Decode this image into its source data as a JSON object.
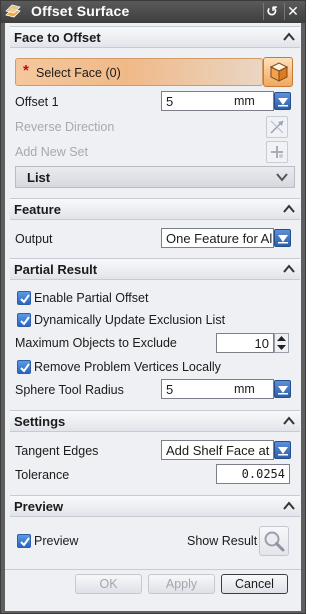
{
  "window": {
    "title": "Offset Surface",
    "controls": {
      "reset": "↺",
      "close": "✕"
    }
  },
  "sections": {
    "face_to_offset": {
      "title": "Face to Offset",
      "select_face": {
        "required_marker": "*",
        "label": "Select Face (0)"
      },
      "offset": {
        "label": "Offset 1",
        "value": "5",
        "unit": "mm"
      },
      "reverse_direction": {
        "label": "Reverse Direction"
      },
      "add_new_set": {
        "label": "Add New Set"
      },
      "list": {
        "label": "List"
      }
    },
    "feature": {
      "title": "Feature",
      "output": {
        "label": "Output",
        "value": "One Feature for Al"
      }
    },
    "partial_result": {
      "title": "Partial Result",
      "enable_partial_offset": {
        "label": "Enable Partial Offset",
        "checked": true
      },
      "dynamically_update": {
        "label": "Dynamically Update Exclusion List",
        "checked": true
      },
      "max_objects": {
        "label": "Maximum Objects to Exclude",
        "value": "10"
      },
      "remove_problem_vertices": {
        "label": "Remove Problem Vertices Locally",
        "checked": true
      },
      "sphere_tool_radius": {
        "label": "Sphere Tool Radius",
        "value": "5",
        "unit": "mm"
      }
    },
    "settings": {
      "title": "Settings",
      "tangent_edges": {
        "label": "Tangent Edges",
        "value": "Add Shelf Face at"
      },
      "tolerance": {
        "label": "Tolerance",
        "value": "0.0254"
      }
    },
    "preview": {
      "title": "Preview",
      "preview_checkbox": {
        "label": "Preview",
        "checked": true
      },
      "show_result": {
        "label": "Show Result"
      }
    }
  },
  "footer": {
    "ok": "OK",
    "apply": "Apply",
    "cancel": "Cancel"
  },
  "colors": {
    "accent_orange": "#f0b988",
    "accent_blue": "#2a64c2",
    "title_bar": "#4a4a4a"
  }
}
